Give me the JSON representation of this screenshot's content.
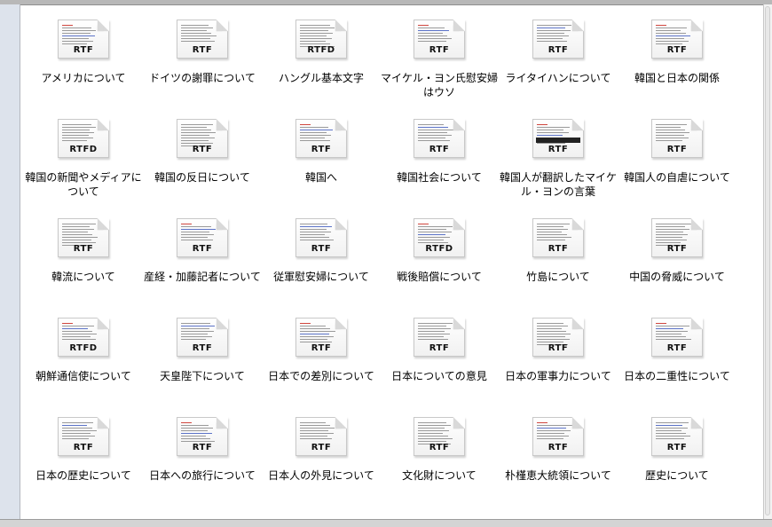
{
  "files": [
    {
      "name": "アメリカについて",
      "type": "RTF"
    },
    {
      "name": "ドイツの謝罪について",
      "type": "RTF"
    },
    {
      "name": "ハングル基本文字",
      "type": "RTFD"
    },
    {
      "name": "マイケル・ヨン氏慰安婦はウソ",
      "type": "RTF"
    },
    {
      "name": "ライタイハンについて",
      "type": "RTF"
    },
    {
      "name": "韓国と日本の関係",
      "type": "RTF"
    },
    {
      "name": "韓国の新聞やメディアについて",
      "type": "RTFD"
    },
    {
      "name": "韓国の反日について",
      "type": "RTF"
    },
    {
      "name": "韓国へ",
      "type": "RTF"
    },
    {
      "name": "韓国社会について",
      "type": "RTF"
    },
    {
      "name": "韓国人が翻訳したマイケル・ヨンの言葉",
      "type": "RTF"
    },
    {
      "name": "韓国人の自虐について",
      "type": "RTF"
    },
    {
      "name": "韓流について",
      "type": "RTF"
    },
    {
      "name": "産経・加藤記者について",
      "type": "RTF"
    },
    {
      "name": "従軍慰安婦について",
      "type": "RTF"
    },
    {
      "name": "戦後賠償について",
      "type": "RTFD"
    },
    {
      "name": "竹島について",
      "type": "RTF"
    },
    {
      "name": "中国の脅威について",
      "type": "RTF"
    },
    {
      "name": "朝鮮通信使について",
      "type": "RTFD"
    },
    {
      "name": "天皇陛下について",
      "type": "RTF"
    },
    {
      "name": "日本での差別について",
      "type": "RTF"
    },
    {
      "name": "日本についての意見",
      "type": "RTF"
    },
    {
      "name": "日本の軍事力について",
      "type": "RTF"
    },
    {
      "name": "日本の二重性について",
      "type": "RTF"
    },
    {
      "name": "日本の歴史について",
      "type": "RTF"
    },
    {
      "name": "日本への旅行について",
      "type": "RTF"
    },
    {
      "name": "日本人の外見について",
      "type": "RTF"
    },
    {
      "name": "文化財について",
      "type": "RTF"
    },
    {
      "name": "朴槿恵大統領について",
      "type": "RTF"
    },
    {
      "name": "歴史について",
      "type": "RTF"
    }
  ]
}
